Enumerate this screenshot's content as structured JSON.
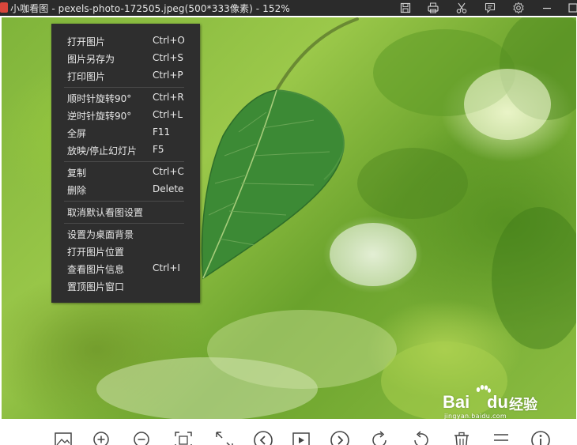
{
  "window": {
    "app_name": "小咖看图",
    "title": "小咖看图 - pexels-photo-172505.jpeg(500*333像素) - 152%",
    "buttons": [
      "save-icon",
      "print-icon",
      "cut-icon",
      "comment-icon",
      "settings-icon",
      "minimize-icon",
      "maximize-icon"
    ]
  },
  "context_menu": {
    "groups": [
      [
        {
          "label": "打开图片",
          "shortcut": "Ctrl+O"
        },
        {
          "label": "图片另存为",
          "shortcut": "Ctrl+S"
        },
        {
          "label": "打印图片",
          "shortcut": "Ctrl+P"
        }
      ],
      [
        {
          "label": "顺时针旋转90°",
          "shortcut": "Ctrl+R"
        },
        {
          "label": "逆时针旋转90°",
          "shortcut": "Ctrl+L"
        },
        {
          "label": "全屏",
          "shortcut": "F11"
        },
        {
          "label": "放映/停止幻灯片",
          "shortcut": "F5"
        }
      ],
      [
        {
          "label": "复制",
          "shortcut": "Ctrl+C"
        },
        {
          "label": "删除",
          "shortcut": "Delete"
        }
      ],
      [
        {
          "label": "取消默认看图设置",
          "shortcut": ""
        }
      ],
      [
        {
          "label": "设置为桌面背景",
          "shortcut": ""
        },
        {
          "label": "打开图片位置",
          "shortcut": ""
        },
        {
          "label": "查看图片信息",
          "shortcut": "Ctrl+I"
        },
        {
          "label": "置顶图片窗口",
          "shortcut": ""
        }
      ]
    ]
  },
  "watermark": {
    "brand_left": "Bai",
    "brand_right": "du",
    "product": "经验",
    "url": "jingyan.baidu.com"
  },
  "toolbar": {
    "icons": [
      "image-icon",
      "zoom-in-icon",
      "zoom-out-icon",
      "fit-window-icon",
      "actual-size-icon",
      "previous-icon",
      "slideshow-icon",
      "next-icon",
      "rotate-right-icon",
      "rotate-left-icon",
      "delete-icon",
      "menu-icon",
      "info-icon"
    ]
  },
  "colors": {
    "titlebar_bg": "#2b2b2b",
    "menu_bg": "#2e2e2e",
    "menu_text": "#e8e8e8",
    "toolbar_icon": "#444444"
  }
}
